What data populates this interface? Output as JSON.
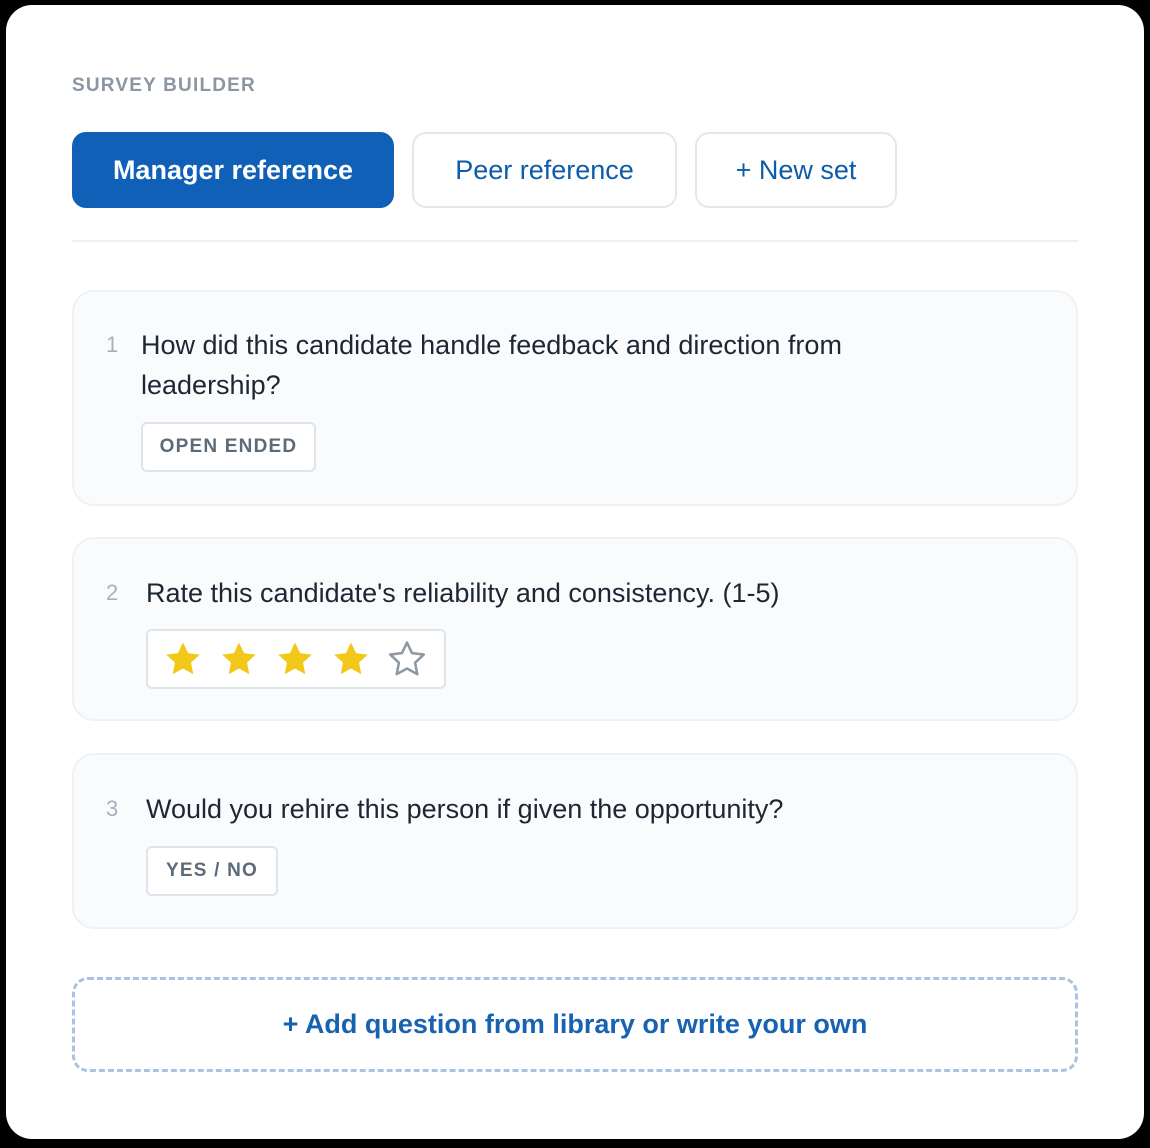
{
  "header": {
    "section_label": "SURVEY BUILDER"
  },
  "tabs": [
    {
      "label": "Manager reference",
      "active": true
    },
    {
      "label": "Peer reference",
      "active": false
    },
    {
      "label": "+ New set",
      "active": false
    }
  ],
  "questions": [
    {
      "number": "1",
      "text": "How did this candidate handle feedback and direction from leadership?",
      "type_label": "OPEN ENDED"
    },
    {
      "number": "2",
      "text": "Rate this candidate's reliability and consistency. (1-5)",
      "rating": {
        "value": 4,
        "max": 5
      }
    },
    {
      "number": "3",
      "text": "Would you rehire this person if given the opportunity?",
      "type_label": "YES / NO"
    }
  ],
  "add_question_label": "+ Add question from library or write your own",
  "colors": {
    "accent": "#0f60b6",
    "star_filled": "#f2c81b",
    "star_empty": "#8d98a3"
  }
}
